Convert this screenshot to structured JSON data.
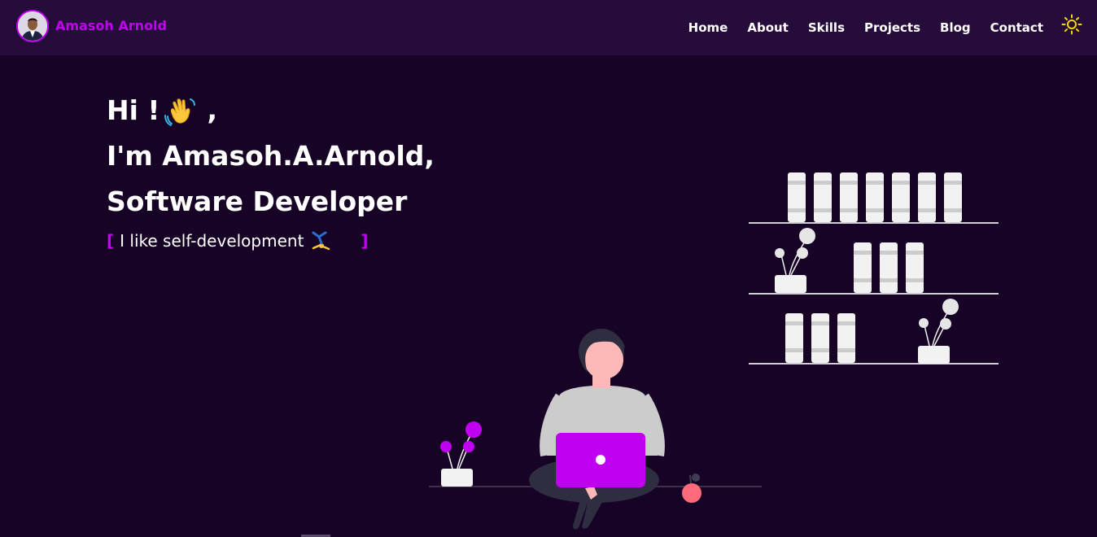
{
  "nav": {
    "brand_name": "Amasoh Arnold",
    "links": [
      {
        "label": "Home"
      },
      {
        "label": "About"
      },
      {
        "label": "Skills"
      },
      {
        "label": "Projects"
      },
      {
        "label": "Blog"
      },
      {
        "label": "Contact"
      }
    ],
    "theme_icon": "sun-icon"
  },
  "hero": {
    "greeting": "Hi !",
    "greeting_suffix": ",",
    "intro": "I'm Amasoh.A.Arnold,",
    "role": "Software Developer",
    "tagline_open": "[",
    "tagline_text": "I like self-development",
    "tagline_close": "]"
  },
  "colors": {
    "background": "#160325",
    "navbar": "#260c3a",
    "accent": "#c000f0",
    "sun": "#f5d900"
  },
  "icons": {
    "wave": "waving-hand-icon",
    "cartwheel": "person-cartwheeling-icon"
  }
}
